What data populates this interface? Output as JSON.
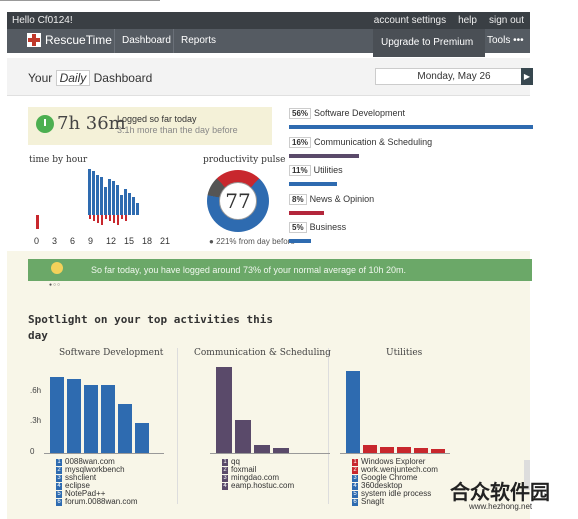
{
  "header": {
    "hello": "Hello Cf0124!",
    "links": [
      "account settings",
      "help",
      "sign out"
    ]
  },
  "nav": {
    "brand": "RescueTime",
    "tabs": [
      "Dashboard",
      "Reports"
    ],
    "upgrade": "Upgrade to Premium",
    "upgrade_icon": "?",
    "tools": "Tools",
    "more": "•••"
  },
  "dashboard": {
    "your": "Your",
    "period": "Daily",
    "label": "Dashboard",
    "date": "Monday, May 26",
    "prev": "◀",
    "next": "▶"
  },
  "logged": {
    "time": "7h 36m",
    "text": "Logged so far today",
    "sub": "3.1h more than the day before"
  },
  "time_by_hour": {
    "title": "time by hour",
    "ticks": [
      "0",
      "3",
      "6",
      "9",
      "12",
      "15",
      "18",
      "21"
    ]
  },
  "pulse": {
    "title": "productivity pulse",
    "value": "77",
    "note": "221% from day before"
  },
  "categories": [
    {
      "pct": "56%",
      "name": "Software Development",
      "value": 56,
      "color": "#2e6bb0"
    },
    {
      "pct": "16%",
      "name": "Communication & Scheduling",
      "value": 16,
      "color": "#5a4a6a"
    },
    {
      "pct": "11%",
      "name": "Utilities",
      "value": 11,
      "color": "#2e6bb0"
    },
    {
      "pct": "8%",
      "name": "News & Opinion",
      "value": 8,
      "color": "#b3263b"
    },
    {
      "pct": "5%",
      "name": "Business",
      "value": 5,
      "color": "#2e6bb0"
    }
  ],
  "banner": {
    "message": "So far today, you have logged around 73% of your normal average of 10h 20m.",
    "dots": "●○○"
  },
  "spotlight": {
    "title": "Spotlight on your top activities this day",
    "yticks": [
      ".6h",
      ".3h",
      "0"
    ],
    "columns": [
      {
        "title": "Software Development",
        "color": "#2e6bb0",
        "items": [
          "0088wan.com",
          "mysqlworkbench",
          "sshclient",
          "eclipse",
          "NotePad++",
          "forum.0088wan.com"
        ]
      },
      {
        "title": "Communication & Scheduling",
        "color": "#5a4a6a",
        "items": [
          "qq",
          "foxmail",
          "mingdao.com",
          "eamp.hostuc.com"
        ]
      },
      {
        "title": "Utilities",
        "color": "#2e6bb0",
        "items": [
          "Windows Explorer",
          "work.wenjuntech.com",
          "Google Chrome",
          "360desktop",
          "system idle process",
          "SnagIt"
        ]
      }
    ]
  },
  "watermark": {
    "name": "合众软件园",
    "url": "www.hezhong.net"
  }
}
